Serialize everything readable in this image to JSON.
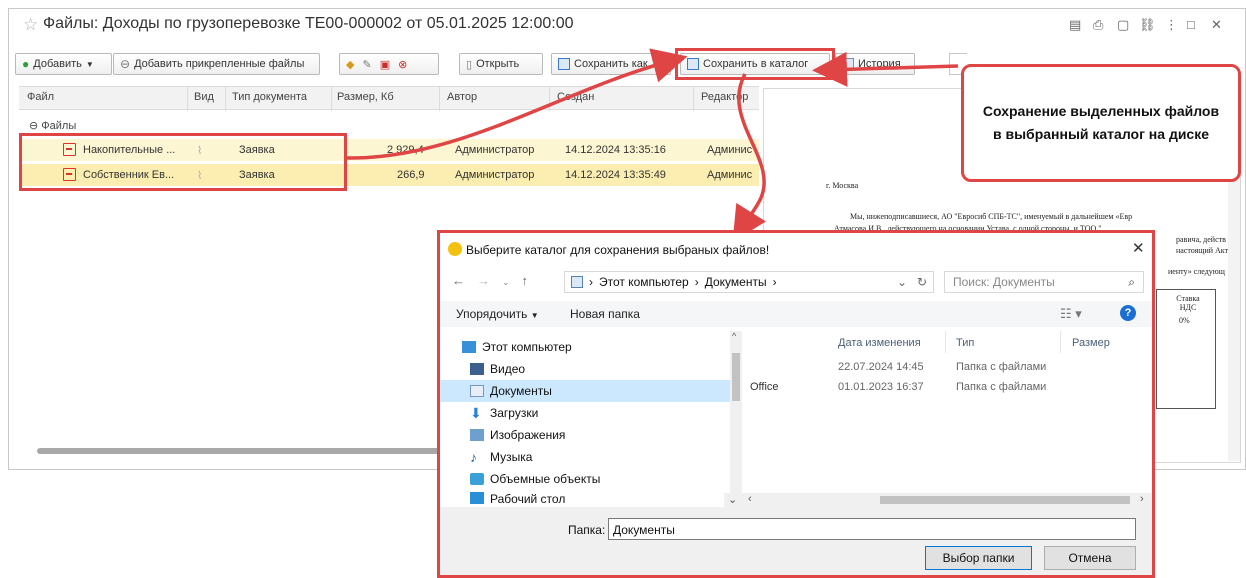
{
  "window": {
    "title": "Файлы: Доходы по грузоперевозке ТЕ00-000002 от 05.01.2025 12:00:00"
  },
  "toolbar": {
    "add_label": "Добавить",
    "add_attached_label": "Добавить прикрепленные файлы",
    "open_label": "Открыть",
    "save_as_label": "Сохранить как...",
    "save_to_dir_label": "Сохранить в каталог",
    "history_label": "История"
  },
  "grid": {
    "columns": [
      "Файл",
      "Вид",
      "Тип документа",
      "Размер, Кб",
      "Автор",
      "Создан",
      "Редактор"
    ],
    "group_label": "Файлы",
    "rows": [
      {
        "name": "Накопительные ...",
        "type": "Заявка",
        "size": "2 929,4",
        "author": "Администратор",
        "created": "14.12.2024 13:35:16",
        "editor": "Админис"
      },
      {
        "name": "Собственник Ев...",
        "type": "Заявка",
        "size": "266,9",
        "author": "Администратор",
        "created": "14.12.2024 13:35:49",
        "editor": "Админис"
      }
    ]
  },
  "preview": {
    "city": "г. Москва",
    "text1": "Мы, нижеподписавшиеся, АО \"Евросиб СПБ-ТС\", именуемый в дальнейшем «Евр",
    "text2": "Атмасова И.В., действующего на основании Устава, с одной стороны, и ТОО \"",
    "text3": "равича, действ",
    "text4": "настоящий Акт о",
    "text5": "иенту» следующ",
    "vat_header": "Ставка НДС",
    "vat_value": "0%"
  },
  "callout": {
    "text": "Сохранение выделенных файлов в выбранный каталог на диске"
  },
  "dialog": {
    "title": "Выберите каталог для сохранения выбраных файлов!",
    "address": {
      "root": "Этот компьютер",
      "folder": "Документы"
    },
    "search_placeholder": "Поиск: Документы",
    "organize_label": "Упорядочить",
    "new_folder_label": "Новая папка",
    "nav_items": [
      "Этот компьютер",
      "Видео",
      "Документы",
      "Загрузки",
      "Изображения",
      "Музыка",
      "Объемные объекты",
      "Рабочий стол"
    ],
    "columns": [
      "Дата изменения",
      "Тип",
      "Размер"
    ],
    "files": [
      {
        "name": "",
        "date": "22.07.2024 14:45",
        "type": "Папка с файлами"
      },
      {
        "name": "Office",
        "date": "01.01.2023 16:37",
        "type": "Папка с файлами"
      }
    ],
    "folder_label": "Папка:",
    "folder_value": "Документы",
    "select_button": "Выбор папки",
    "cancel_button": "Отмена"
  },
  "colors": {
    "highlight": "#e04545",
    "selected_row": "#fbeeb0",
    "row_yellow": "#fdf6d3",
    "nav_selected": "#cce8ff"
  }
}
